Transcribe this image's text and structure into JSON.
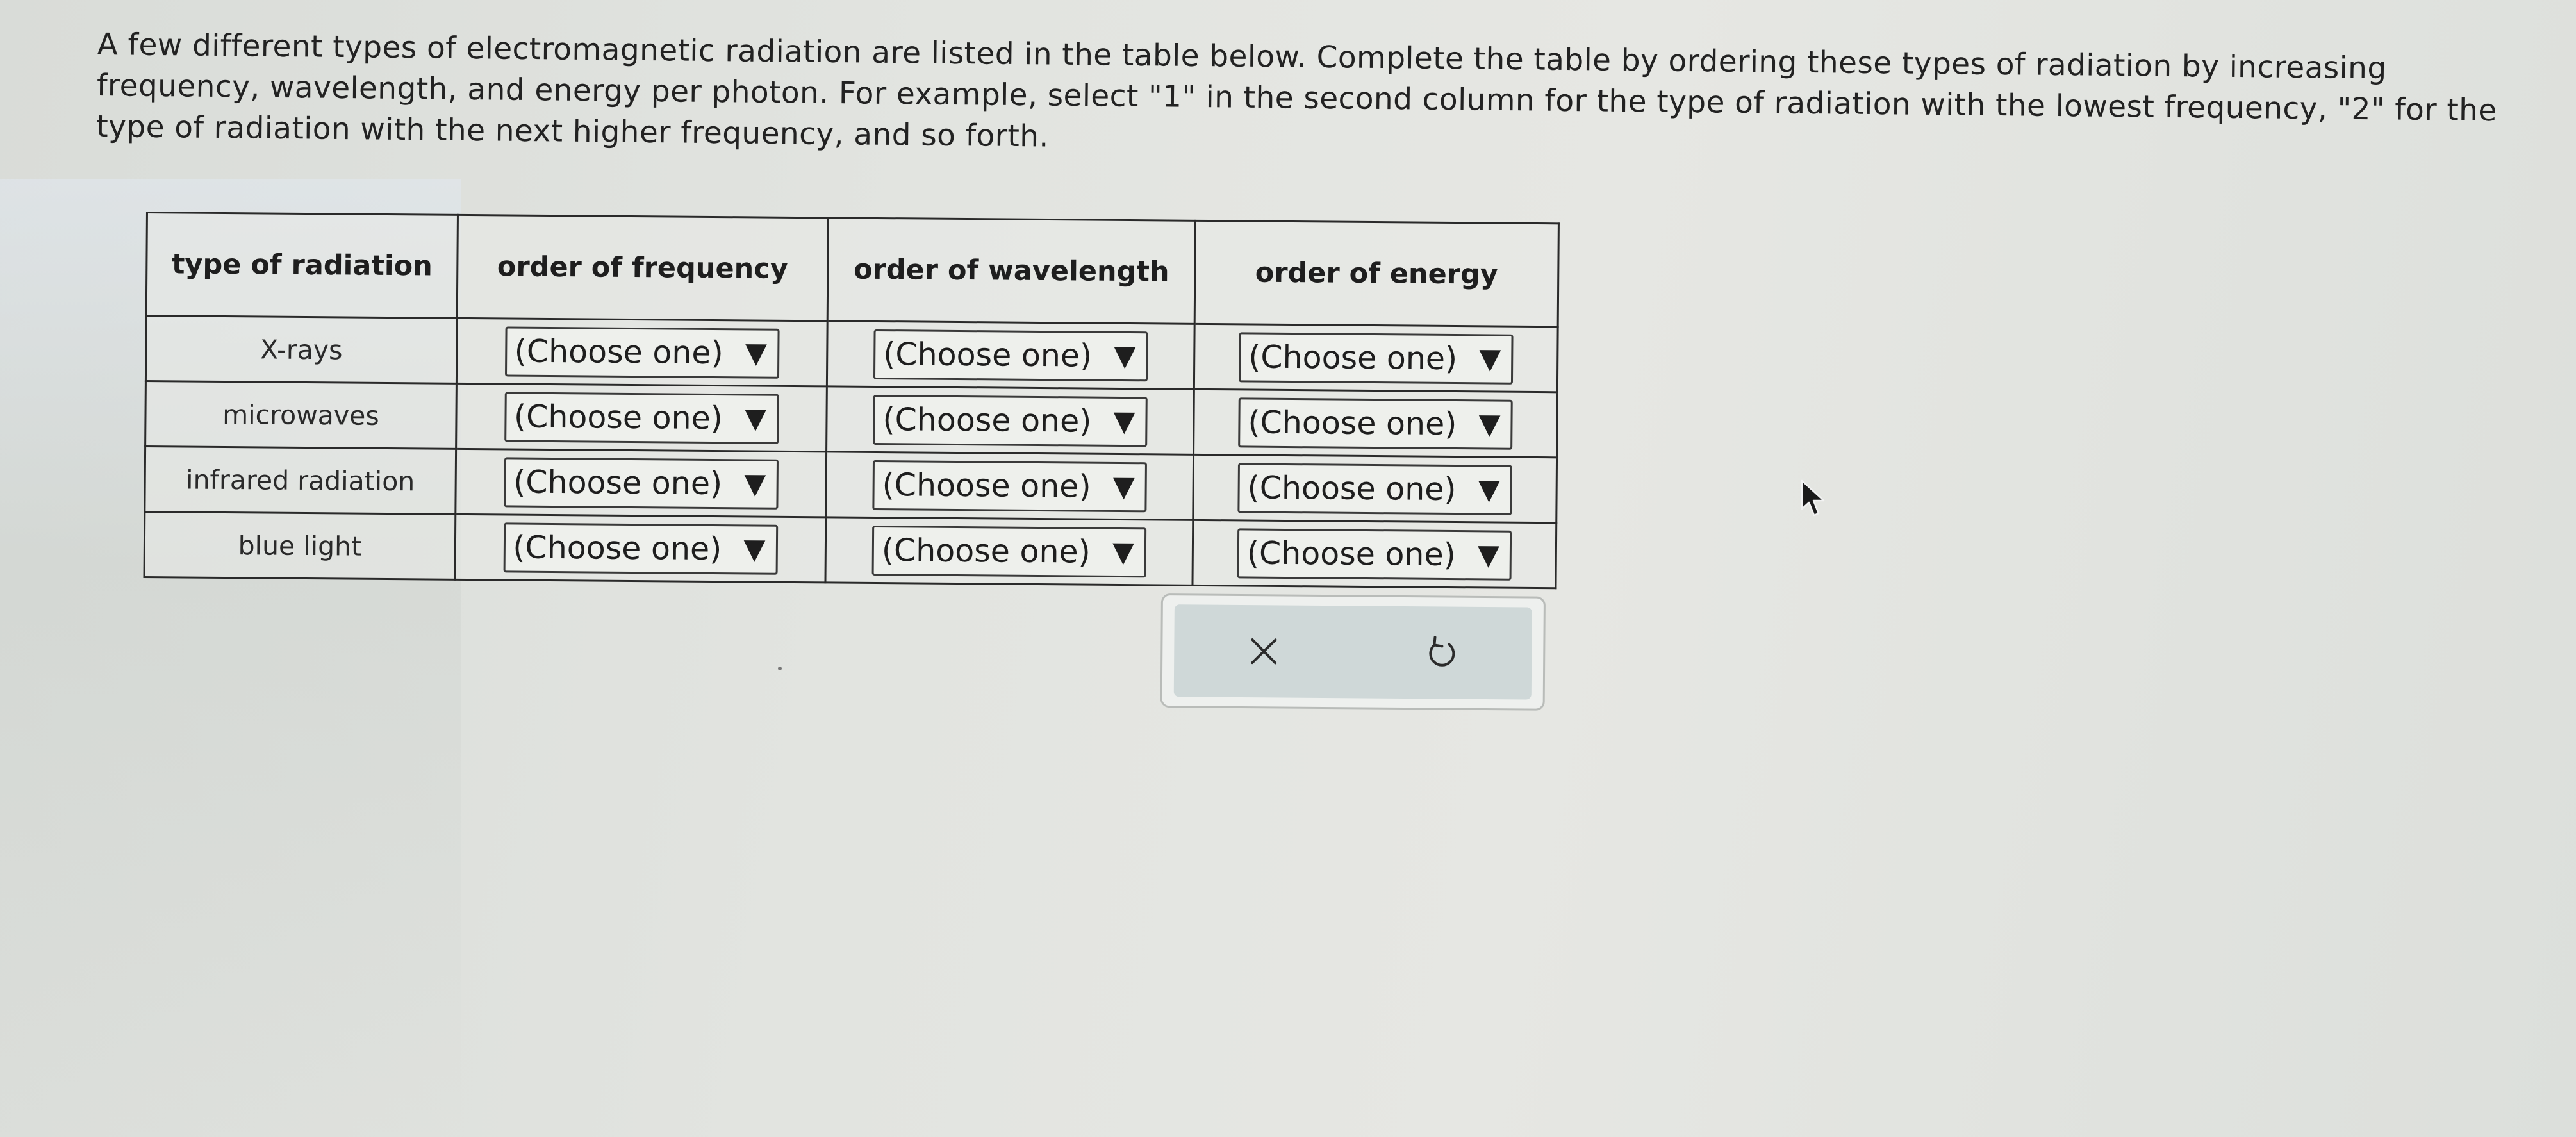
{
  "instructions": "A few different types of electromagnetic radiation are listed in the table below. Complete the table by ordering these types of radiation by increasing frequency, wavelength, and energy per photon. For example, select \"1\" in the second column for the type of radiation with the lowest frequency, \"2\" for the type of radiation with the next higher frequency, and so forth.",
  "table": {
    "headers": [
      "type of radiation",
      "order of frequency",
      "order of wavelength",
      "order of energy"
    ],
    "rows": [
      {
        "type": "X-rays",
        "frequency": "(Choose one)",
        "wavelength": "(Choose one)",
        "energy": "(Choose one)"
      },
      {
        "type": "microwaves",
        "frequency": "(Choose one)",
        "wavelength": "(Choose one)",
        "energy": "(Choose one)"
      },
      {
        "type": "infrared radiation",
        "frequency": "(Choose one)",
        "wavelength": "(Choose one)",
        "energy": "(Choose one)"
      },
      {
        "type": "blue light",
        "frequency": "(Choose one)",
        "wavelength": "(Choose one)",
        "energy": "(Choose one)"
      }
    ],
    "dropdown_arrow": "▼"
  },
  "actions": {
    "clear_icon": "close-icon",
    "reset_icon": "undo-icon"
  },
  "colors": {
    "background": "#e2e4e0",
    "panel_inner": "#cfd8d8",
    "border": "#2a2a2a"
  }
}
